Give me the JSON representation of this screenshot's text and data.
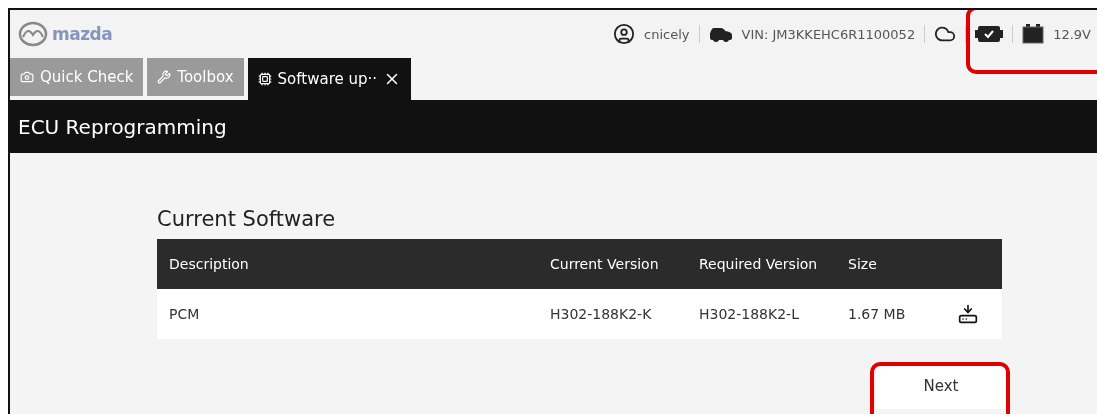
{
  "header": {
    "logo_text": "mazda",
    "user": "cnicely",
    "vin": "VIN: JM3KKEHC6R1100052",
    "voltage": "12.9V"
  },
  "tabs": [
    {
      "label": "Quick Check",
      "kind": "camera",
      "selected": false,
      "closable": false
    },
    {
      "label": "Toolbox",
      "kind": "tools",
      "selected": false,
      "closable": false
    },
    {
      "label": "Software up··",
      "kind": "chip",
      "selected": true,
      "closable": true
    }
  ],
  "page_title": "ECU Reprogramming",
  "section_title": "Current Software",
  "table": {
    "columns": [
      "Description",
      "Current Version",
      "Required Version",
      "Size"
    ],
    "rows": [
      {
        "cells": [
          "PCM",
          "H302-188K2-K",
          "H302-188K2-L",
          "1.67 MB"
        ]
      }
    ]
  },
  "next_button": "Next"
}
